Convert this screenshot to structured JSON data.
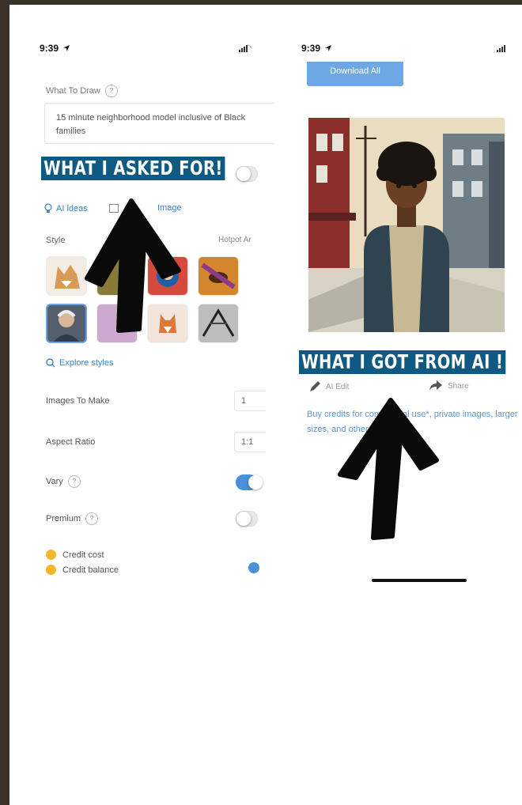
{
  "left_screen": {
    "time": "9:39",
    "what_to_draw": {
      "label": "What To Draw",
      "help": "?",
      "value": "15 minute neighborhood model inclusive of Black families"
    },
    "banner": "WHAT I ASKED FOR!",
    "ai_ideas": "AI ideas",
    "image_link": "Image",
    "style": {
      "label": "Style",
      "right_label": "Hotpot Ar"
    },
    "explore_styles": "Explore styles",
    "images_to_make": {
      "label": "Images To Make",
      "value": "1"
    },
    "aspect_ratio": {
      "label": "Aspect Ratio",
      "value": "1:1"
    },
    "vary": {
      "label": "Vary",
      "help": "?",
      "on": true
    },
    "premium": {
      "label": "Premium",
      "help": "?",
      "on": false
    },
    "credit_cost": "Credit cost",
    "credit_balance": "Credit balance"
  },
  "right_screen": {
    "time": "9:39",
    "download_all": "Download All",
    "banner": "WHAT I GOT FROM AI  !",
    "ai_edit": "AI Edit",
    "share": "Share",
    "credits_text": "Buy credits for commercial use*, private images, larger sizes, and other benefits"
  },
  "colors": {
    "banner_bg": "#0f5a82",
    "accent": "#4a90d9",
    "link": "#3b82c4",
    "coin": "#f5b72c"
  }
}
